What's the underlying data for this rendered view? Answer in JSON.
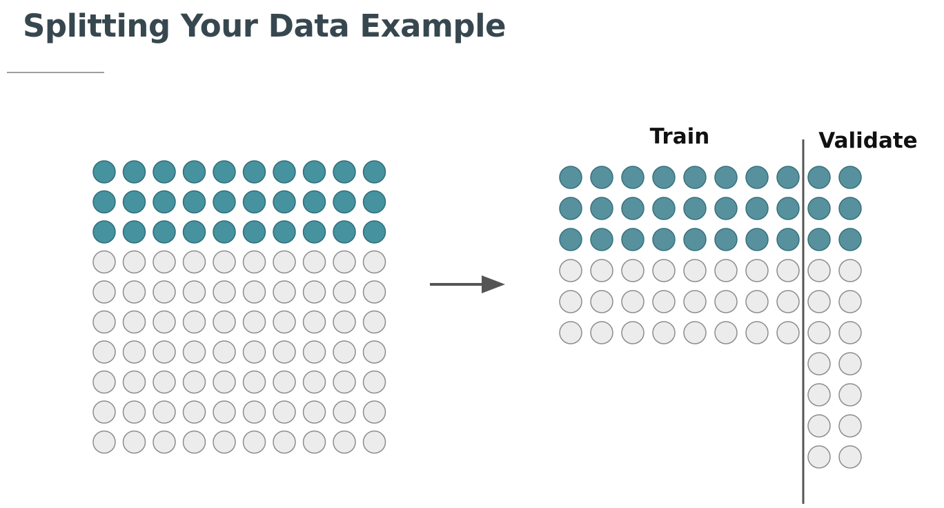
{
  "slide": {
    "title": "Splitting Your Data Example"
  },
  "diagram": {
    "train_label": "Train",
    "validate_label": "Validate",
    "colors": {
      "filled": "#46929f",
      "filled_stroke": "#2f6e79",
      "filled_split": "#57919d",
      "filled_split_stroke": "#37707c",
      "empty": "#ececec",
      "empty_stroke": "#8c8c8c",
      "arrow": "#555555",
      "divider": "#555555"
    },
    "original_set": {
      "rows": 10,
      "cols": 10,
      "filled_rows": 3
    },
    "train_set": {
      "rows": 6,
      "cols": 8,
      "filled_rows": 3
    },
    "validate_set": {
      "rows": 10,
      "cols": 2,
      "filled_rows": 3
    }
  }
}
